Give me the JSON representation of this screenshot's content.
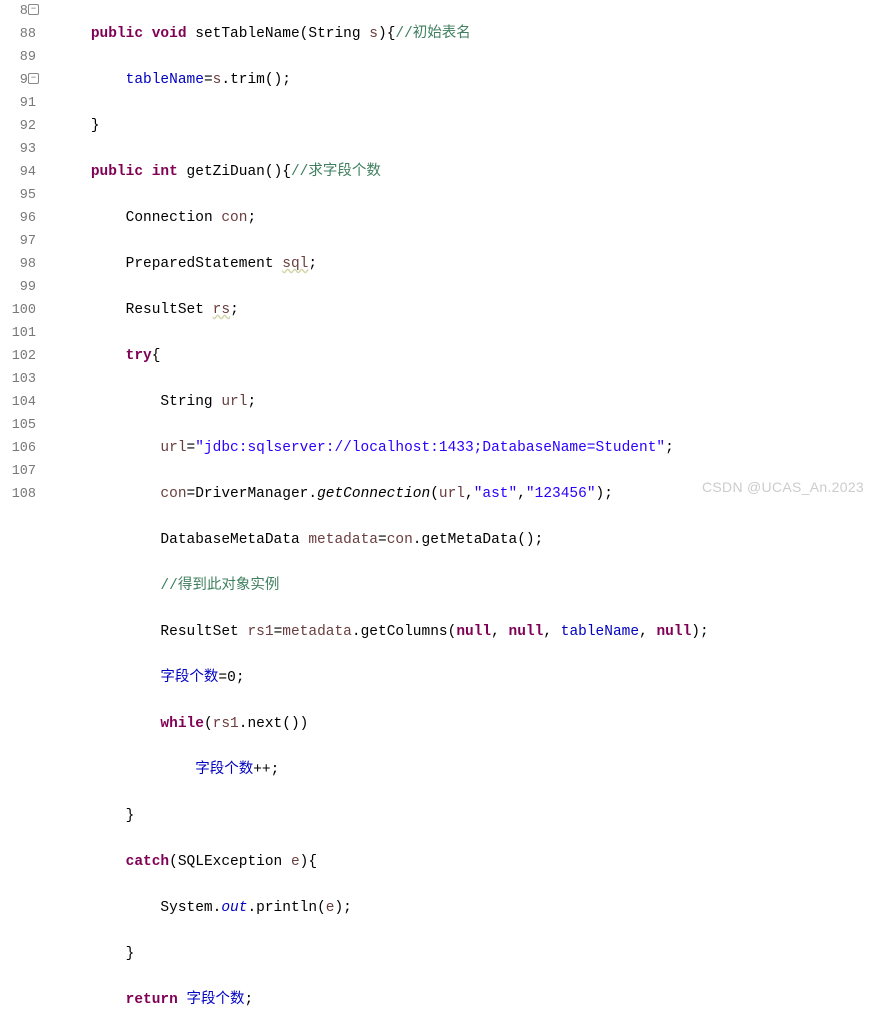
{
  "gutter": {
    "start": 87,
    "end": 108,
    "fold_lines": [
      87,
      90
    ]
  },
  "watermark": "CSDN @UCAS_An.2023",
  "code": {
    "l87": {
      "kw1": "public",
      "kw2": "void",
      "name": "setTableName",
      "param_type": "String",
      "param": "s",
      "brace": "{",
      "cmt": "//初始表名"
    },
    "l88": {
      "field": "tableName",
      "eq": "=",
      "var": "s",
      "dot": ".",
      "call": "trim",
      "paren": "();"
    },
    "l89": {
      "brace": "}"
    },
    "l90": {
      "kw1": "public",
      "kw2": "int",
      "name": "getZiDuan",
      "paren": "()",
      "brace": "{",
      "cmt": "//求字段个数"
    },
    "l91": {
      "type": "Connection",
      "var": "con",
      "semi": ";"
    },
    "l92": {
      "type": "PreparedStatement",
      "var": "sql",
      "semi": ";"
    },
    "l93": {
      "type": "ResultSet",
      "var": "rs",
      "semi": ";"
    },
    "l94": {
      "kw": "try",
      "brace": "{"
    },
    "l95": {
      "type": "String",
      "var": "url",
      "semi": ";"
    },
    "l96": {
      "var": "url",
      "eq": "=",
      "str": "\"jdbc:sqlserver://localhost:1433;DatabaseName=Student\"",
      "semi": ";"
    },
    "l97": {
      "var": "con",
      "eq": "=",
      "cls": "DriverManager",
      "dot": ".",
      "call": "getConnection",
      "open": "(",
      "arg1": "url",
      "c1": ",",
      "arg2": "\"ast\"",
      "c2": ",",
      "arg3": "\"123456\"",
      "close": ");"
    },
    "l98": {
      "type": "DatabaseMetaData",
      "var": "metadata",
      "eq": "=",
      "obj": "con",
      "dot": ".",
      "call": "getMetaData",
      "paren": "();"
    },
    "l99": {
      "cmt": "//得到此对象实例"
    },
    "l100": {
      "type": "ResultSet",
      "var": "rs1",
      "eq": "=",
      "obj": "metadata",
      "dot": ".",
      "call": "getColumns",
      "open": "(",
      "n1": "null",
      "c1": ", ",
      "n2": "null",
      "c2": ", ",
      "arg": "tableName",
      "c3": ", ",
      "n3": "null",
      "close": ");"
    },
    "l101": {
      "field": "字段个数",
      "eq": "=",
      "num": "0",
      "semi": ";"
    },
    "l102": {
      "kw": "while",
      "open": "(",
      "obj": "rs1",
      "dot": ".",
      "call": "next",
      "paren": "()",
      "close": ")"
    },
    "l103": {
      "field": "字段个数",
      "op": "++;"
    },
    "l104": {
      "brace": "}"
    },
    "l105": {
      "kw": "catch",
      "open": "(",
      "type": "SQLException",
      "var": "e",
      "close": ")",
      "brace": "{"
    },
    "l106": {
      "cls": "System",
      "d1": ".",
      "fld": "out",
      "d2": ".",
      "call": "println",
      "open": "(",
      "arg": "e",
      "close": ");"
    },
    "l107": {
      "brace": "}"
    },
    "l108": {
      "kw": "return",
      "field": "字段个数",
      "semi": ";"
    }
  }
}
